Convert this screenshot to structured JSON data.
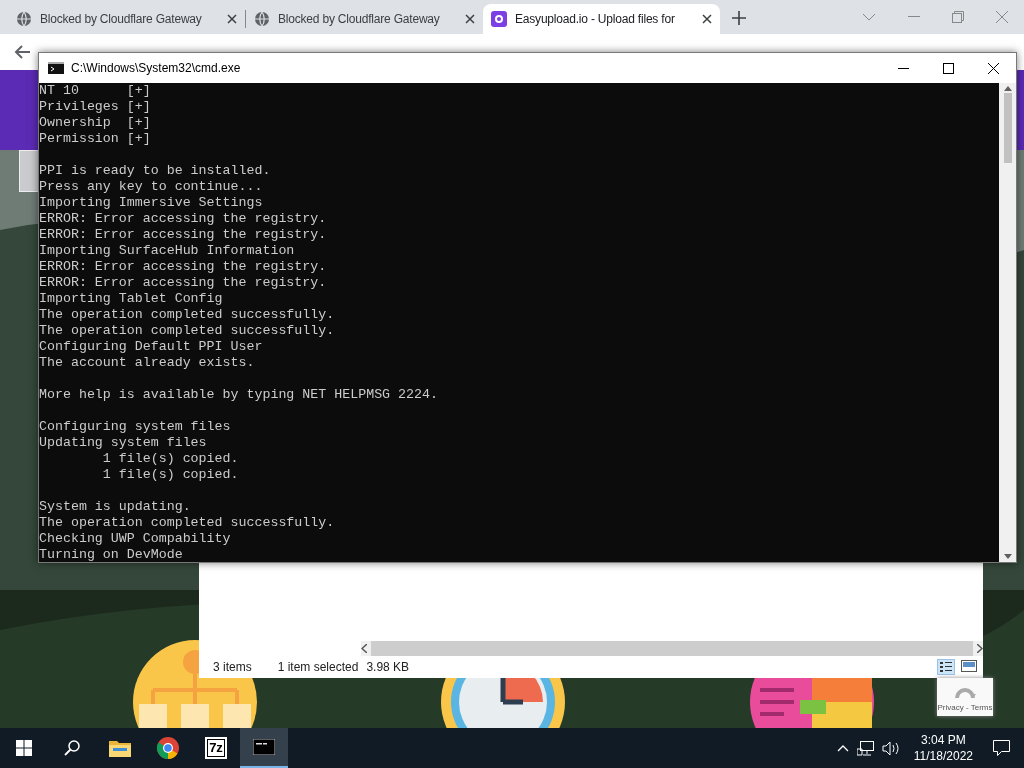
{
  "browser": {
    "tabs": [
      {
        "title": "Blocked by Cloudflare Gateway",
        "selected": false,
        "kind": "globe"
      },
      {
        "title": "Blocked by Cloudflare Gateway",
        "selected": false,
        "kind": "globe"
      },
      {
        "title": "Easyupload.io - Upload files for",
        "selected": true,
        "kind": "site"
      }
    ]
  },
  "cmd": {
    "title": "C:\\Windows\\System32\\cmd.exe",
    "blocks": [
      [
        "NT 10      [+]",
        "Privileges [+]",
        "Ownership  [+]",
        "Permission [+]"
      ],
      [
        "PPI is ready to be installed.",
        "Press any key to continue...",
        "Importing Immersive Settings",
        "ERROR: Error accessing the registry.",
        "ERROR: Error accessing the registry.",
        "Importing SurfaceHub Information",
        "ERROR: Error accessing the registry.",
        "ERROR: Error accessing the registry.",
        "Importing Tablet Config",
        "The operation completed successfully.",
        "The operation completed successfully.",
        "Configuring Default PPI User",
        "The account already exists."
      ],
      [
        "More help is available by typing NET HELPMSG 2224."
      ],
      [
        "Configuring system files",
        "Updating system files",
        "        1 file(s) copied.",
        "        1 file(s) copied."
      ],
      [
        "System is updating.",
        "The operation completed successfully.",
        "Checking UWP Compability",
        "Turning on DevMode"
      ]
    ]
  },
  "explorer": {
    "item_count": "3 items",
    "selection": "1 item selected",
    "size": "3.98 KB"
  },
  "recaptcha": {
    "links": "Privacy - Terms"
  },
  "taskbar": {
    "apps": [
      {
        "kind": "explorer",
        "selected": false
      },
      {
        "kind": "chrome",
        "selected": false
      },
      {
        "kind": "archive",
        "label": "7z",
        "selected": false
      },
      {
        "kind": "console",
        "selected": true
      }
    ],
    "time": "3:04 PM",
    "date": "11/18/2022"
  }
}
